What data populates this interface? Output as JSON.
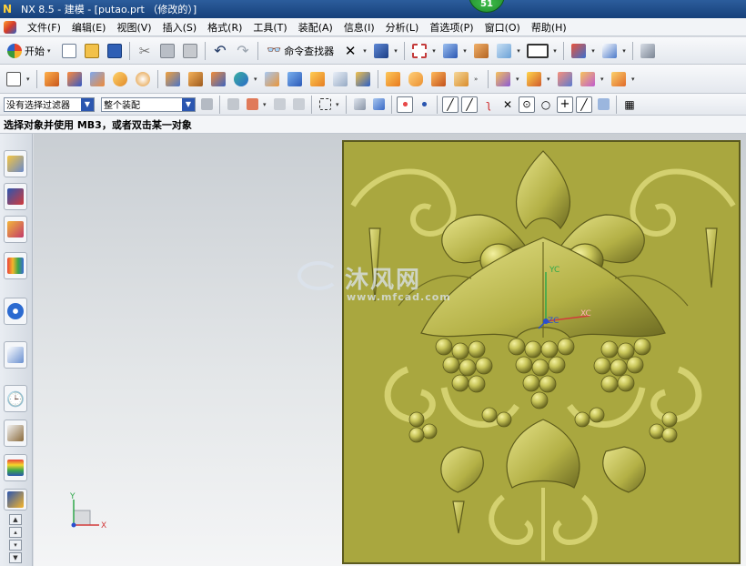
{
  "window": {
    "title": "NX 8.5 - 建模 - [putao.prt （修改的）]",
    "badge": "51"
  },
  "menu": [
    "文件(F)",
    "编辑(E)",
    "视图(V)",
    "插入(S)",
    "格式(R)",
    "工具(T)",
    "装配(A)",
    "信息(I)",
    "分析(L)",
    "首选项(P)",
    "窗口(O)",
    "帮助(H)"
  ],
  "toolbar1": {
    "start_label": "开始",
    "command_finder_label": "命令查找器"
  },
  "selection_bar": {
    "type_filter": "没有选择过滤器",
    "scope_filter": "整个装配"
  },
  "prompt": "选择对象并使用 MB3，或者双击某一对象",
  "watermark": {
    "brand": "沐风网",
    "url": "www.mfcad.com"
  },
  "wcs": {
    "x_label": "XC",
    "y_label": "YC",
    "z_label": "ZC"
  },
  "triad": {
    "x_label": "X",
    "y_label": "Y"
  },
  "colors": {
    "model_surface": "#a9a73f",
    "title_bar": "#1e4c8a",
    "axis_x": "#d23a3a",
    "axis_y": "#2fa84a",
    "axis_z": "#2a4fcf"
  }
}
